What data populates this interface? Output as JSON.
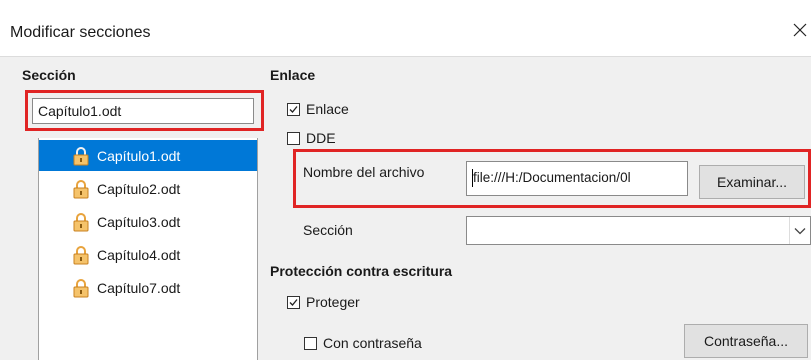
{
  "window": {
    "title": "Modificar secciones",
    "close_icon": "close-icon"
  },
  "left": {
    "heading": "Sección",
    "name_input_value": "Capítulo1.odt",
    "items": [
      {
        "label": "Capítulo1.odt",
        "selected": true
      },
      {
        "label": "Capítulo2.odt",
        "selected": false
      },
      {
        "label": "Capítulo3.odt",
        "selected": false
      },
      {
        "label": "Capítulo4.odt",
        "selected": false
      },
      {
        "label": "Capítulo7.odt",
        "selected": false
      }
    ]
  },
  "link": {
    "heading": "Enlace",
    "enlace_label": "Enlace",
    "enlace_checked": true,
    "dde_label": "DDE",
    "dde_checked": false,
    "filename_label": "Nombre del archivo",
    "filename_value": "file:///H:/Documentacion/0l",
    "browse_button": "Examinar...",
    "section_label": "Sección",
    "section_value": ""
  },
  "protection": {
    "heading": "Protección contra escritura",
    "protect_label": "Proteger",
    "protect_checked": true,
    "password_label": "Con contraseña",
    "password_checked": false,
    "password_button": "Contraseña..."
  },
  "colors": {
    "selection": "#0078d7",
    "highlight_box": "#e02424",
    "lock_icon": "#e8a33d"
  }
}
